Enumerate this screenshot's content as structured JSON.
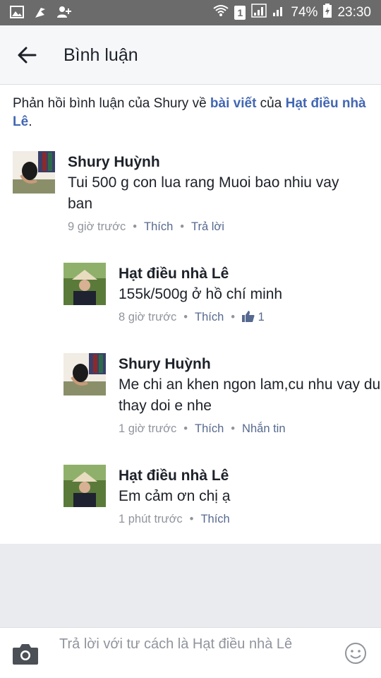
{
  "status_bar": {
    "icons_left": [
      "image-icon",
      "flag-icon",
      "add-friend-icon"
    ],
    "sim": "1",
    "battery": "74%",
    "time": "23:30"
  },
  "header": {
    "title": "Bình luận"
  },
  "context": {
    "prefix": "Phản hồi bình luận của Shury về ",
    "post_link": "bài viết",
    "middle": " của ",
    "page_link": "Hạt điều nhà Lê",
    "suffix": "."
  },
  "comments": [
    {
      "author": "Shury Huỳnh",
      "text": "Tui 500 g con lua rang Muoi bao nhiu vay ban",
      "time": "9 giờ trước",
      "actions": [
        "Thích",
        "Trả lời"
      ]
    },
    {
      "author": "Hạt điều nhà Lê",
      "text": "155k/500g ở hồ chí minh",
      "time": "8 giờ trước",
      "actions": [
        "Thích"
      ],
      "likes": "1"
    },
    {
      "author": "Shury Huỳnh",
      "text": "Me chi an khen ngon lam,cu nhu vay dung thay doi e nhe",
      "time": "1 giờ trước",
      "actions": [
        "Thích",
        "Nhắn tin"
      ]
    },
    {
      "author": "Hạt điều nhà Lê",
      "text": "Em cảm ơn chị ạ",
      "time": "1 phút trước",
      "actions": [
        "Thích"
      ]
    }
  ],
  "composer": {
    "placeholder": "Trả lời với tư cách là Hạt điều nhà Lê"
  },
  "colors": {
    "link": "#4267b2",
    "meta": "#90949c",
    "status_bar": "#6b6b6b"
  }
}
